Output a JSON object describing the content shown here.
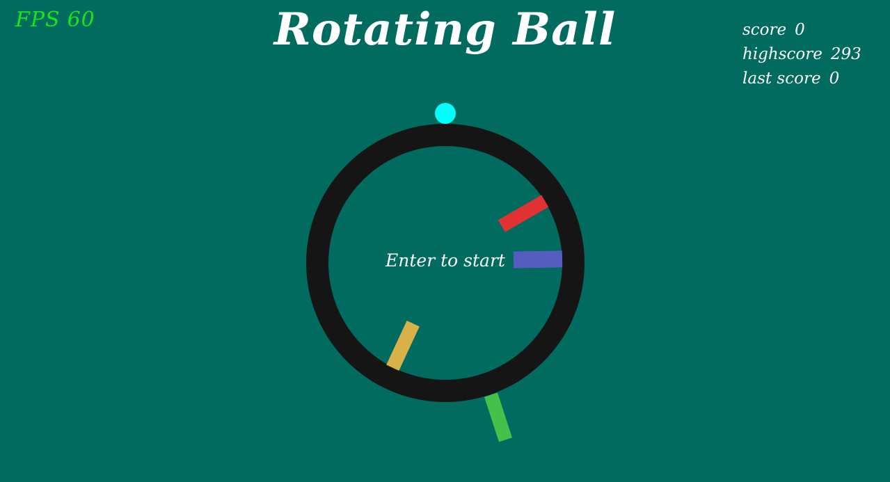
{
  "hud": {
    "fps_label": "FPS",
    "fps_value": "60"
  },
  "title": "Rotating Ball",
  "scores": {
    "score_label": "score",
    "score_value": "0",
    "highscore_label": "highscore",
    "highscore_value": "293",
    "last_score_label": "last score",
    "last_score_value": "0"
  },
  "prompt": "Enter to start",
  "colors": {
    "background": "#006b5e",
    "ring": "#151515",
    "ball": "#00ffff",
    "fps_text": "#16e61a",
    "text": "#ffffff",
    "obstacle_red": "#e03232",
    "obstacle_blue": "#565dbf",
    "obstacle_yellow": "#d8b14a",
    "obstacle_green": "#45c04a"
  }
}
